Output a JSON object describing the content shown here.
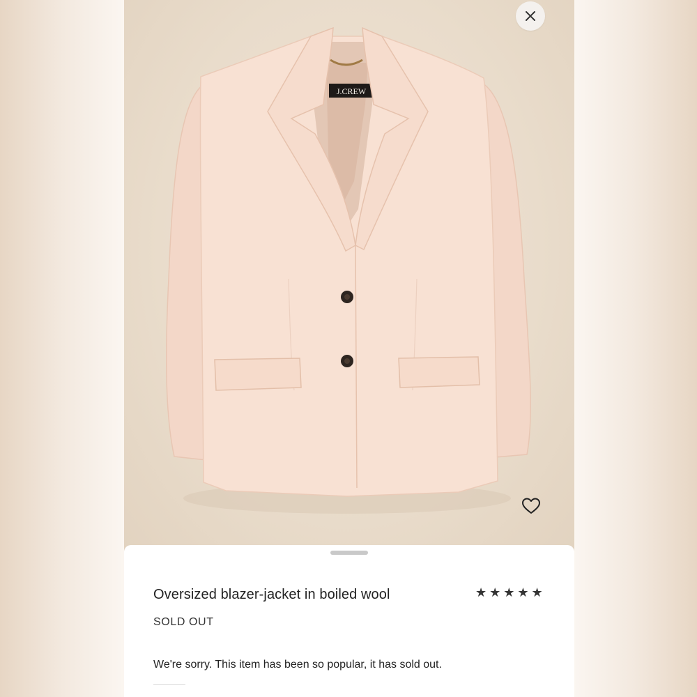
{
  "product": {
    "title": "Oversized blazer-jacket in boiled wool",
    "status": "SOLD OUT",
    "message": "We're sorry. This item has been so popular, it has sold out.",
    "rating_stars": "★★★★★",
    "rating_value": 5,
    "brand_label": "J.CREW",
    "image_name": "pink-boiled-wool-blazer"
  },
  "icons": {
    "close": "close-icon",
    "favorite": "heart-outline-icon",
    "drag": "drag-handle"
  },
  "colors": {
    "jacket": "#f7ded0",
    "background": "#ece0d0",
    "sheet": "#ffffff",
    "text": "#222222"
  }
}
